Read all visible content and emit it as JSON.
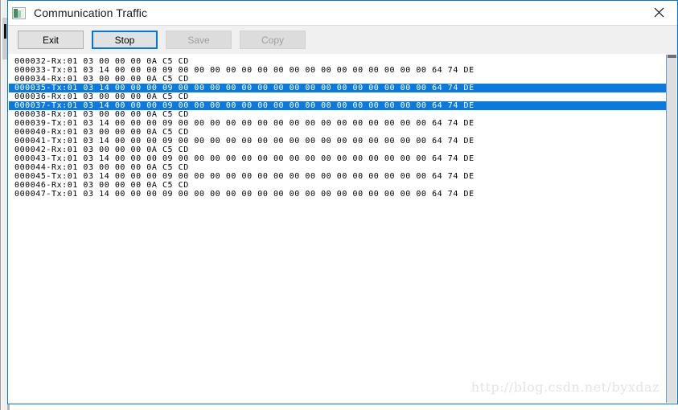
{
  "window": {
    "title": "Communication Traffic",
    "icon": "app-window-icon",
    "close_label": "✕",
    "accent_color": "#0078d7"
  },
  "toolbar": {
    "buttons": [
      {
        "label": "Exit",
        "name": "exit-button",
        "state": "normal",
        "enabled": true
      },
      {
        "label": "Stop",
        "name": "stop-button",
        "state": "default",
        "enabled": true
      },
      {
        "label": "Save",
        "name": "save-button",
        "state": "disabled",
        "enabled": false
      },
      {
        "label": "Copy",
        "name": "copy-button",
        "state": "disabled",
        "enabled": false
      }
    ]
  },
  "log": {
    "selection_color": "#0a7ae0",
    "lines": [
      {
        "text": "000032-Rx:01 03 00 00 00 0A C5 CD",
        "selected": false
      },
      {
        "text": "000033-Tx:01 03 14 00 00 00 09 00 00 00 00 00 00 00 00 00 00 00 00 00 00 00 00 64 74 DE",
        "selected": false
      },
      {
        "text": "000034-Rx:01 03 00 00 00 0A C5 CD",
        "selected": false
      },
      {
        "text": "000035-Tx:01 03 14 00 00 00 09 00 00 00 00 00 00 00 00 00 00 00 00 00 00 00 00 64 74 DE",
        "selected": true
      },
      {
        "text": "000036-Rx:01 03 00 00 00 0A C5 CD",
        "selected": false
      },
      {
        "text": "000037-Tx:01 03 14 00 00 00 09 00 00 00 00 00 00 00 00 00 00 00 00 00 00 00 00 64 74 DE",
        "selected": true
      },
      {
        "text": "000038-Rx:01 03 00 00 00 0A C5 CD",
        "selected": false
      },
      {
        "text": "000039-Tx:01 03 14 00 00 00 09 00 00 00 00 00 00 00 00 00 00 00 00 00 00 00 00 64 74 DE",
        "selected": false
      },
      {
        "text": "000040-Rx:01 03 00 00 00 0A C5 CD",
        "selected": false
      },
      {
        "text": "000041-Tx:01 03 14 00 00 00 09 00 00 00 00 00 00 00 00 00 00 00 00 00 00 00 00 64 74 DE",
        "selected": false
      },
      {
        "text": "000042-Rx:01 03 00 00 00 0A C5 CD",
        "selected": false
      },
      {
        "text": "000043-Tx:01 03 14 00 00 00 09 00 00 00 00 00 00 00 00 00 00 00 00 00 00 00 00 64 74 DE",
        "selected": false
      },
      {
        "text": "000044-Rx:01 03 00 00 00 0A C5 CD",
        "selected": false
      },
      {
        "text": "000045-Tx:01 03 14 00 00 00 09 00 00 00 00 00 00 00 00 00 00 00 00 00 00 00 00 64 74 DE",
        "selected": false
      },
      {
        "text": "000046-Rx:01 03 00 00 00 0A C5 CD",
        "selected": false
      },
      {
        "text": "000047-Tx:01 03 14 00 00 00 09 00 00 00 00 00 00 00 00 00 00 00 00 00 00 00 00 64 74 DE",
        "selected": false
      }
    ]
  },
  "watermark": {
    "text": "http://blog.csdn.net/byxdaz"
  }
}
